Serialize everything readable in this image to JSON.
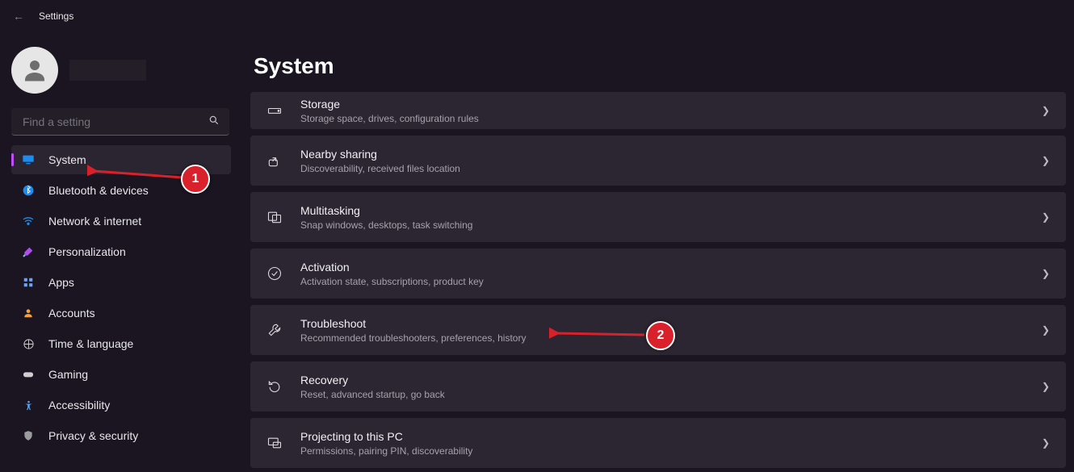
{
  "app_title": "Settings",
  "search": {
    "placeholder": "Find a setting"
  },
  "nav": {
    "items": [
      {
        "label": "System",
        "icon": "monitor",
        "color": "#1d8cf0",
        "active": true
      },
      {
        "label": "Bluetooth & devices",
        "icon": "bluetooth",
        "color": "#1d8cf0"
      },
      {
        "label": "Network & internet",
        "icon": "wifi",
        "color": "#1d8cf0"
      },
      {
        "label": "Personalization",
        "icon": "brush",
        "color": "#b04cf0"
      },
      {
        "label": "Apps",
        "icon": "grid",
        "color": "#6ca4f5"
      },
      {
        "label": "Accounts",
        "icon": "person",
        "color": "#f4a23a"
      },
      {
        "label": "Time & language",
        "icon": "clock",
        "color": "#cfcfcf"
      },
      {
        "label": "Gaming",
        "icon": "gamepad",
        "color": "#cfcfcf"
      },
      {
        "label": "Accessibility",
        "icon": "access",
        "color": "#5ea7f2"
      },
      {
        "label": "Privacy & security",
        "icon": "shield",
        "color": "#9c9c9c"
      }
    ]
  },
  "page": {
    "title": "System",
    "cards": [
      {
        "title": "Storage",
        "sub": "Storage space, drives, configuration rules",
        "icon": "drive",
        "short": true
      },
      {
        "title": "Nearby sharing",
        "sub": "Discoverability, received files location",
        "icon": "share"
      },
      {
        "title": "Multitasking",
        "sub": "Snap windows, desktops, task switching",
        "icon": "multitask"
      },
      {
        "title": "Activation",
        "sub": "Activation state, subscriptions, product key",
        "icon": "check"
      },
      {
        "title": "Troubleshoot",
        "sub": "Recommended troubleshooters, preferences, history",
        "icon": "wrench"
      },
      {
        "title": "Recovery",
        "sub": "Reset, advanced startup, go back",
        "icon": "recovery"
      },
      {
        "title": "Projecting to this PC",
        "sub": "Permissions, pairing PIN, discoverability",
        "icon": "project"
      }
    ]
  },
  "annotations": {
    "arrow1_num": "1",
    "arrow2_num": "2"
  }
}
